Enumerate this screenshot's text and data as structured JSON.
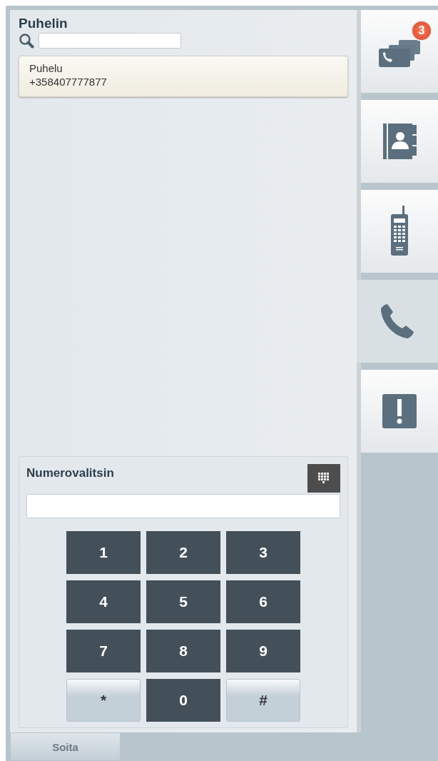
{
  "phone": {
    "title": "Puhelin",
    "calls": [
      {
        "label": "Puhelu",
        "number": "+358407777877"
      }
    ]
  },
  "dialer": {
    "title": "Numerovalitsin",
    "keys": [
      {
        "label": "1",
        "kind": "digit"
      },
      {
        "label": "2",
        "kind": "digit"
      },
      {
        "label": "3",
        "kind": "digit"
      },
      {
        "label": "4",
        "kind": "digit"
      },
      {
        "label": "5",
        "kind": "digit"
      },
      {
        "label": "6",
        "kind": "digit"
      },
      {
        "label": "7",
        "kind": "digit"
      },
      {
        "label": "8",
        "kind": "digit"
      },
      {
        "label": "9",
        "kind": "digit"
      },
      {
        "label": "*",
        "kind": "symbol"
      },
      {
        "label": "0",
        "kind": "digit"
      },
      {
        "label": "#",
        "kind": "symbol"
      }
    ]
  },
  "call_button": "Soita",
  "sidebar": {
    "tabs": [
      {
        "kind": "calls",
        "selected": false,
        "badge": "3"
      },
      {
        "kind": "contacts",
        "selected": false
      },
      {
        "kind": "handset",
        "selected": false
      },
      {
        "kind": "phone",
        "selected": true
      },
      {
        "kind": "alert",
        "selected": false
      }
    ]
  }
}
